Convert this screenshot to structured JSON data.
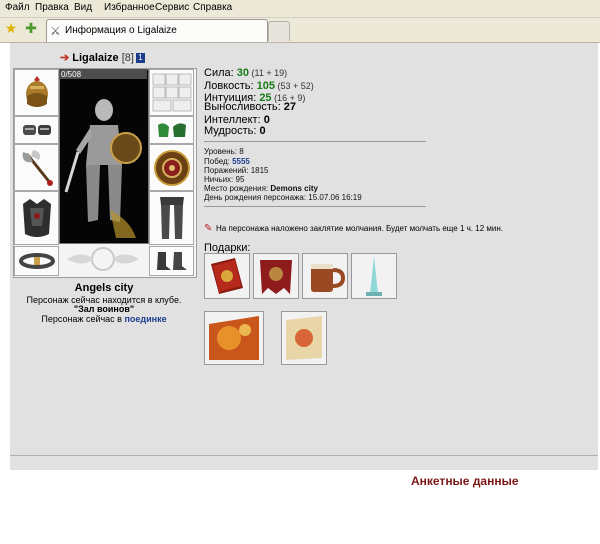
{
  "menu": [
    "Файл",
    "Правка",
    "Вид",
    "Избранное",
    "Сервис",
    "Справка"
  ],
  "tab": {
    "title": "Информация о Ligalaize"
  },
  "character": {
    "name": "Ligalaize",
    "level_label": "[8]",
    "badge": "1",
    "hp": "0/508",
    "city_name": "Angels city",
    "location_text": "Персонаж сейчас находится в клубе.",
    "club_name": "\"Зал воинов\"",
    "fight_text": "Персонаж сейчас в",
    "fight_link": "поединке"
  },
  "stats": [
    {
      "label": "Сила: ",
      "value": "30",
      "detail": " (11 + 19)",
      "color": "#197a19"
    },
    {
      "label": "Ловкость: ",
      "value": "105",
      "detail": " (53 + 52)",
      "color": "#197a19"
    },
    {
      "label": "Интуиция: ",
      "value": "25",
      "detail": " (16 + 9)",
      "color": "#197a19"
    },
    {
      "label": "Выносливость: ",
      "value": "27",
      "detail": "",
      "color": "#000000"
    },
    {
      "label": "Интеллект: ",
      "value": "0",
      "detail": "",
      "color": "#000000"
    },
    {
      "label": "Мудрость: ",
      "value": "0",
      "detail": "",
      "color": "#000000"
    }
  ],
  "info": [
    {
      "label": "Уровень: ",
      "value": "8"
    },
    {
      "label": "Побед: ",
      "value": "5555"
    },
    {
      "label": "Поражений: ",
      "value": "1815"
    },
    {
      "label": "Ничьих: ",
      "value": "95"
    },
    {
      "label": "Место рождения: ",
      "value": "Demons city"
    },
    {
      "label": "День рождения персонажа: ",
      "value": "15.07.06 16:19"
    }
  ],
  "silence_text": "На персонажа наложено заклятие молчания. Будет молчать еще 1 ч. 12 мин.",
  "gifts_label": "Подарки:",
  "bottom_heading": "Анкетные данные",
  "colors": {
    "content_bg": "#e1e1e1",
    "accent_red": "#7b1717",
    "stat_green": "#197a19",
    "link_blue": "#1d3f8f"
  }
}
